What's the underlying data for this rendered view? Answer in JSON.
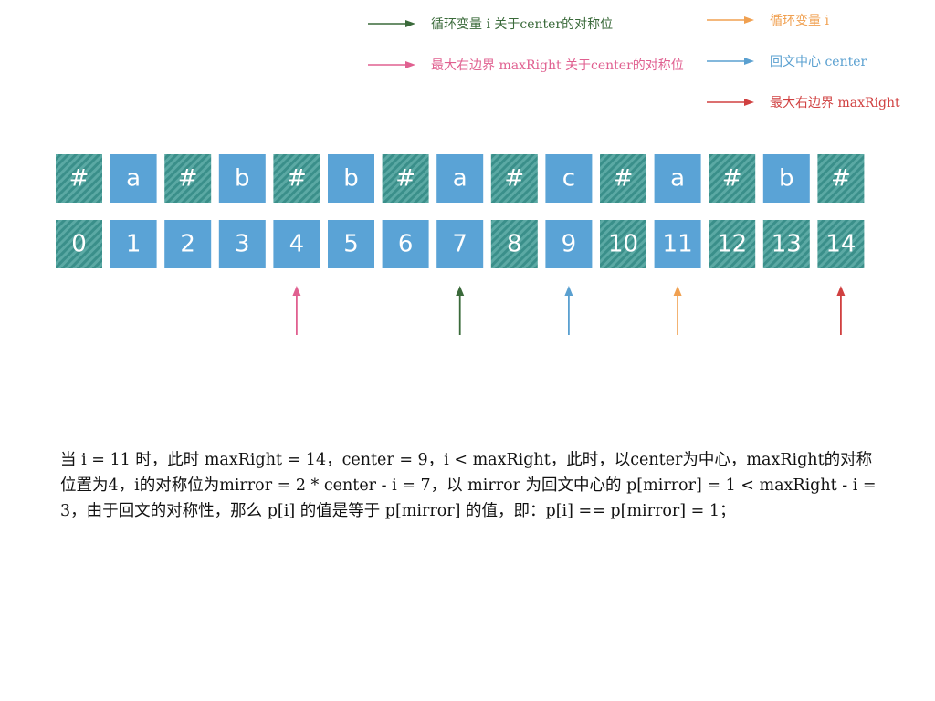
{
  "legend": [
    {
      "label": "循环变量 i 关于center的对称位",
      "color": "#3a6a3a",
      "icon": "arrow-right"
    },
    {
      "label": "循环变量 i",
      "color": "#f0a050",
      "icon": "arrow-right"
    },
    {
      "label": "最大右边界 maxRight 关于center的对称位",
      "color": "#e06090",
      "icon": "arrow-right"
    },
    {
      "label": "回文中心 center",
      "color": "#5aa0d0",
      "icon": "arrow-right"
    },
    {
      "label": "最大右边界 maxRight",
      "color": "#d04040",
      "icon": "arrow-right"
    }
  ],
  "chars": [
    "#",
    "a",
    "#",
    "b",
    "#",
    "b",
    "#",
    "a",
    "#",
    "c",
    "#",
    "a",
    "#",
    "b",
    "#"
  ],
  "indices": [
    "0",
    "1",
    "2",
    "3",
    "4",
    "5",
    "6",
    "7",
    "8",
    "9",
    "10",
    "11",
    "12",
    "13",
    "14"
  ],
  "index_hatched": [
    true,
    false,
    false,
    false,
    false,
    false,
    false,
    false,
    true,
    false,
    true,
    false,
    true,
    true,
    true
  ],
  "colors": {
    "cell_blue": "#5aa3d6",
    "hatch_teal": "#3a8f8a"
  },
  "pointers": [
    {
      "index": 4,
      "color": "#e06090",
      "icon": "arrow-up"
    },
    {
      "index": 7,
      "color": "#3a6a3a",
      "icon": "arrow-up"
    },
    {
      "index": 9,
      "color": "#5aa0d0",
      "icon": "arrow-up"
    },
    {
      "index": 11,
      "color": "#f0a050",
      "icon": "arrow-up"
    },
    {
      "index": 14,
      "color": "#d04040",
      "icon": "arrow-up"
    }
  ],
  "explanation": [
    "当 i = 11 时，此时 maxRight = 14，center = 9，i < maxRight，此时，以center为中心，maxRight的对称",
    "位置为4，i的对称位为mirror = 2 * center - i = 7，以 mirror 为回文中心的 p[mirror] = 1 < maxRight - i =",
    "3，由于回文的对称性，那么 p[i] 的值是等于 p[mirror] 的值，即：p[i] == p[mirror] = 1；"
  ]
}
